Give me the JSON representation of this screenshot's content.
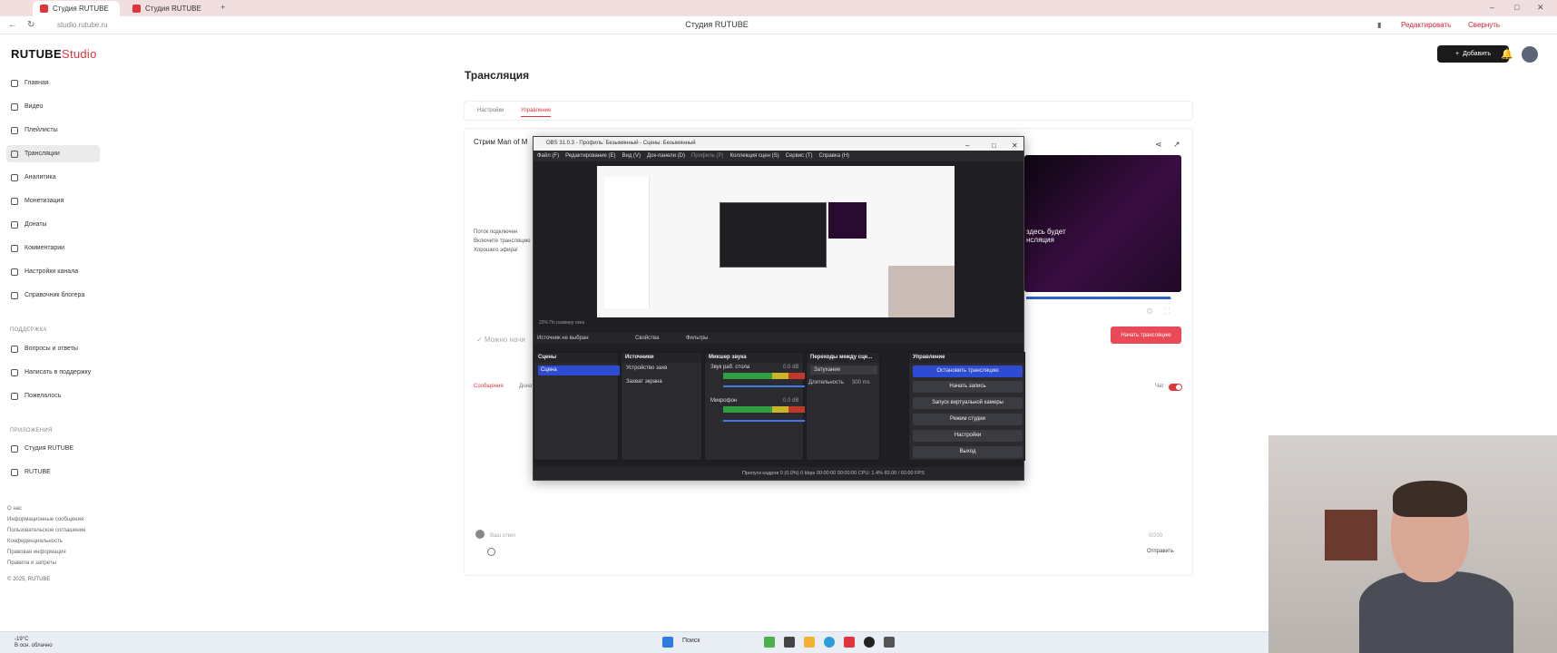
{
  "browser": {
    "tabs": [
      {
        "label": "Студия RUTUBE",
        "active": true
      },
      {
        "label": "Студия RUTUBE",
        "active": false
      }
    ],
    "new_tab": "+",
    "url": "studio.rutube.ru",
    "page_title": "Студия RUTUBE",
    "toolbar": {
      "edit": "Редактировать",
      "collapse": "Свернуть"
    },
    "window_controls": [
      "–",
      "□",
      "✕"
    ]
  },
  "sidebar": {
    "logo_main": "RUTUBE",
    "logo_sub": "Studio",
    "items": [
      {
        "label": "Главная",
        "icon": "home-icon"
      },
      {
        "label": "Видео",
        "icon": "video-icon"
      },
      {
        "label": "Плейлисты",
        "icon": "playlist-icon"
      },
      {
        "label": "Трансляции",
        "icon": "broadcast-icon",
        "active": true
      },
      {
        "label": "Аналитика",
        "icon": "analytics-icon"
      },
      {
        "label": "Монетизация",
        "icon": "money-icon"
      },
      {
        "label": "Донаты",
        "icon": "donate-icon"
      },
      {
        "label": "Комментарии",
        "icon": "comment-icon"
      },
      {
        "label": "Настройки канала",
        "icon": "gear-icon"
      },
      {
        "label": "Справочник блогера",
        "icon": "help-icon"
      }
    ],
    "support_heading": "ПОДДЕРЖКА",
    "support_items": [
      {
        "label": "Вопросы и ответы",
        "icon": "question-icon"
      },
      {
        "label": "Написать в поддержку",
        "icon": "mail-icon"
      },
      {
        "label": "Пожелалось",
        "icon": "feedback-icon"
      }
    ],
    "apps_heading": "ПРИЛОЖЕНИЯ",
    "apps_items": [
      {
        "label": "Студия RUTUBE",
        "icon": "app-icon"
      },
      {
        "label": "RUTUBE",
        "icon": "app-icon"
      }
    ],
    "footer_links": [
      "О нас",
      "Информационные сообщения",
      "Пользовательское соглашение",
      "Конфиденциальность",
      "Правовая информация",
      "Правила и запреты"
    ],
    "copyright": "© 2025, RUTUBE"
  },
  "header": {
    "add_label": "Добавить"
  },
  "main": {
    "title": "Трансляция",
    "tabs": [
      {
        "label": "Настройки"
      },
      {
        "label": "Управление",
        "active": true
      }
    ],
    "stream_name": "Стрим Man of M",
    "connected": "Поток подключен",
    "connected_line2": "Включите трансляцию",
    "connected_line3": "Хорошего эфира!",
    "can_start": "✓ Можно начи",
    "preview_text_1": "здесь будет",
    "preview_text_2": "нсляция",
    "start_button": "Начать трансляцию",
    "chat_tab": "Сообщения",
    "chat_tab2": "Донаты",
    "chat_toggle_label": "Чат",
    "chat_placeholder": "Ваш ответ",
    "chat_counter": "0/200",
    "send": "Отправить"
  },
  "obs": {
    "title": "OBS 31.0.3 - Профиль: Безымянный - Сцены: Безымянный",
    "menu": [
      "Файл (F)",
      "Редактирование (E)",
      "Вид (V)",
      "Док-панели (D)",
      "Профиль (P)",
      "Коллекция сцен (S)",
      "Сервис (T)",
      "Справка (H)"
    ],
    "zoom_status": "22%  По размеру окна",
    "no_source": "Источник не выбран",
    "properties": "Свойства",
    "filters": "Фильтры",
    "docks": {
      "scenes": "Сцены",
      "sources": "Источники",
      "mixer": "Микшер звука",
      "transitions": "Переходы между сце...",
      "controls": "Управление"
    },
    "scene_items": [
      "Сцена"
    ],
    "source_items": [
      "Устройство захв",
      "Захват экрана"
    ],
    "mixer_items": [
      {
        "label": "Звук раб. стола",
        "db": "0.0 dB"
      },
      {
        "label": "Микрофон",
        "db": "0.0 dB"
      }
    ],
    "transition": "Затухание",
    "duration_label": "Длительность",
    "duration_value": "300 ms",
    "controls": [
      "Остановить трансляцию",
      "Начать запись",
      "Запуск виртуальной камеры",
      "Режим студии",
      "Настройки",
      "Выход"
    ],
    "footer": "Пропуск кадров 0 (0.0%)   0 kbps   00:00:00   00:00:00   CPU: 1.4%   60.00 / 60.00 FPS"
  },
  "taskbar": {
    "weather_temp": "-19°C",
    "weather_text": "В осн. облачно",
    "search": "Поиск"
  }
}
